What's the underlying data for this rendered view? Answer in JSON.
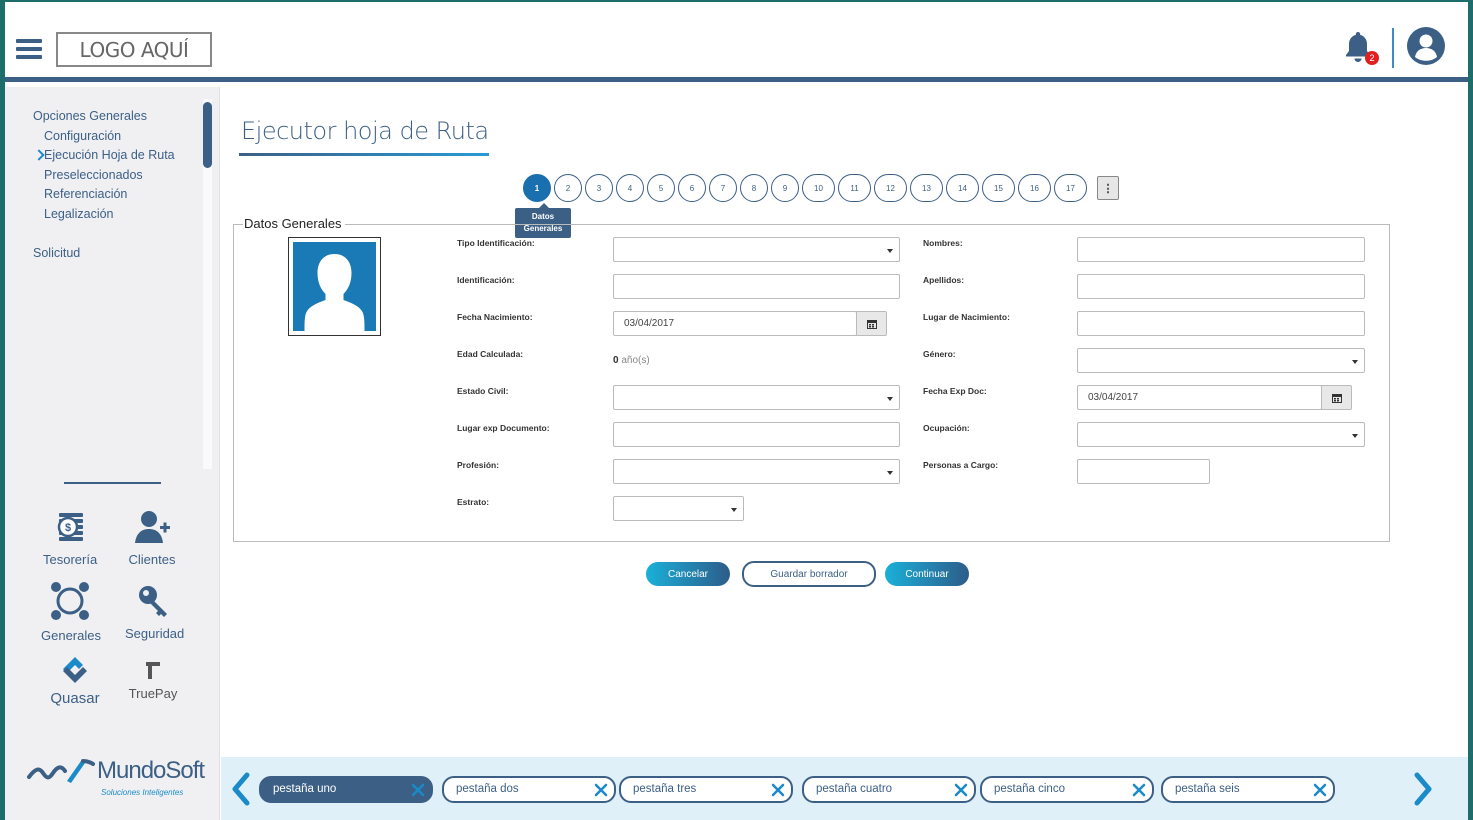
{
  "header": {
    "logo_text": "LOGO AQUÍ",
    "notification_count": "2"
  },
  "sidebar": {
    "menu": [
      {
        "label": "Opciones Generales",
        "level": 0,
        "active": false
      },
      {
        "label": "Configuración",
        "level": 1,
        "active": false
      },
      {
        "label": "Ejecución Hoja de Ruta",
        "level": 1,
        "active": true
      },
      {
        "label": "Preseleccionados",
        "level": 1,
        "active": false
      },
      {
        "label": "Referenciación",
        "level": 1,
        "active": false
      },
      {
        "label": "Legalización",
        "level": 1,
        "active": false
      },
      {
        "label": "",
        "level": 0,
        "active": false
      },
      {
        "label": "Solicitud",
        "level": 0,
        "active": false
      }
    ],
    "modules": {
      "tesoreria": "Tesorería",
      "clientes": "Clientes",
      "generales": "Generales",
      "seguridad": "Seguridad",
      "quasar": "Quasar",
      "truepay": "TruePay"
    },
    "brand_name": "MundoSoft",
    "brand_tagline": "Soluciones Inteligentes"
  },
  "main": {
    "title": "Ejecutor hoja de Ruta",
    "steps": [
      "1",
      "2",
      "3",
      "4",
      "5",
      "6",
      "7",
      "8",
      "9",
      "10",
      "11",
      "12",
      "13",
      "14",
      "15",
      "16",
      "17"
    ],
    "active_step": "1",
    "tooltip": "Datos Generales",
    "section_legend": "Datos Generales",
    "fields": {
      "tipo_identificacion": {
        "label": "Tipo Identificación:",
        "value": ""
      },
      "identificacion": {
        "label": "Identificación:",
        "value": ""
      },
      "fecha_nacimiento": {
        "label": "Fecha Nacimiento:",
        "value": "03/04/2017"
      },
      "edad_calculada": {
        "label": "Edad Calculada:",
        "value": "0",
        "unit": "año(s)"
      },
      "estado_civil": {
        "label": "Estado Civil:",
        "value": ""
      },
      "lugar_exp_documento": {
        "label": "Lugar exp Documento:",
        "value": ""
      },
      "profesion": {
        "label": "Profesión:",
        "value": ""
      },
      "estrato": {
        "label": "Estrato:",
        "value": ""
      },
      "nombres": {
        "label": "Nombres:",
        "value": ""
      },
      "apellidos": {
        "label": "Apellidos:",
        "value": ""
      },
      "lugar_nacimiento": {
        "label": "Lugar de Nacimiento:",
        "value": ""
      },
      "genero": {
        "label": "Género:",
        "value": ""
      },
      "fecha_exp_doc": {
        "label": "Fecha Exp Doc:",
        "value": "03/04/2017"
      },
      "ocupacion": {
        "label": "Ocupación:",
        "value": ""
      },
      "personas_a_cargo": {
        "label": "Personas a Cargo:",
        "value": ""
      }
    },
    "buttons": {
      "cancel": "Cancelar",
      "save_draft": "Guardar borrador",
      "continue": "Continuar"
    }
  },
  "tabs": [
    {
      "label": "pestaña uno",
      "active": true
    },
    {
      "label": "pestaña dos",
      "active": false
    },
    {
      "label": "pestaña tres",
      "active": false
    },
    {
      "label": "pestaña cuatro",
      "active": false
    },
    {
      "label": "pestaña cinco",
      "active": false
    },
    {
      "label": "pestaña seis",
      "active": false
    }
  ],
  "colors": {
    "primary": "#3c5f86",
    "accent": "#1a8ac8",
    "badge": "#e02020",
    "tabbar": "#dff0f8"
  }
}
